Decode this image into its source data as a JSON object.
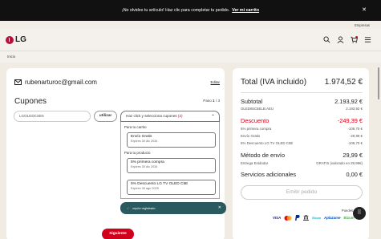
{
  "banner": {
    "message": "¡No olvides tu artículo! Haz clic para completar tu pedido.",
    "link": "Ver mi carrito"
  },
  "header": {
    "top_link": "Empresas",
    "logo_text": "LG",
    "cart_count": "1"
  },
  "breadcrumb": "Inicio",
  "checkout": {
    "email": "rubenarturoc@gmail.com",
    "edit_label": "Editar",
    "section_title": "Cupones",
    "step_label": "Paso",
    "step_current": "1",
    "step_total": "/ 3",
    "coupon_input_value": "LGOLEDCSE5",
    "use_button": "utilizar",
    "dropdown_label": "Haz click y selecciona cupones",
    "dropdown_count": "(3)",
    "group_cart": "Para tu carrito",
    "group_product": "Para tu producto",
    "options": [
      {
        "title": "Envío Gratis",
        "expires": "Expires 30 dic 2034"
      },
      {
        "title": "5% primera compra",
        "expires": "Expires 30 dic 2034"
      },
      {
        "title": "5% Descuento LG TV OLED C5E",
        "expires": "Expires 30 ago 2025"
      }
    ],
    "toast": "cupón registrado",
    "next_button": "Siguiente"
  },
  "summary": {
    "total_label": "Total (IVA incluido)",
    "total_value": "1.974,52 €",
    "subtotal_label": "Subtotal",
    "subtotal_value": "2.193,92 €",
    "sku": "OLED65C5ELB.AEU",
    "sku_value": "2.193,92 €",
    "discount_label": "Descuento",
    "discount_value": "-249,39 €",
    "discounts": [
      {
        "label": "5% primera compra",
        "value": "-109,70 €"
      },
      {
        "label": "Envío Gratis",
        "value": "-29,99 €"
      },
      {
        "label": "5% Descuento LG TV OLED C5E",
        "value": "-109,70 €"
      }
    ],
    "shipping_label": "Método de envío",
    "shipping_value": "29,99 €",
    "shipping_type": "Entrega Estándar",
    "shipping_note": "GRATIS (valorado en 29,99€)",
    "services_label": "Servicios adicionales",
    "services_value": "0,00 €",
    "emit_button": "Emitir pedido",
    "pay_with": "Puedes pagar",
    "payment_logos": [
      "VISA",
      "MC",
      "PayPal",
      "BANK",
      "Bizum",
      "Aplazame",
      "Bizum"
    ],
    "colors": {
      "brand": "#b5123b",
      "cta": "#d0021b",
      "toast": "#2a5a60"
    }
  }
}
